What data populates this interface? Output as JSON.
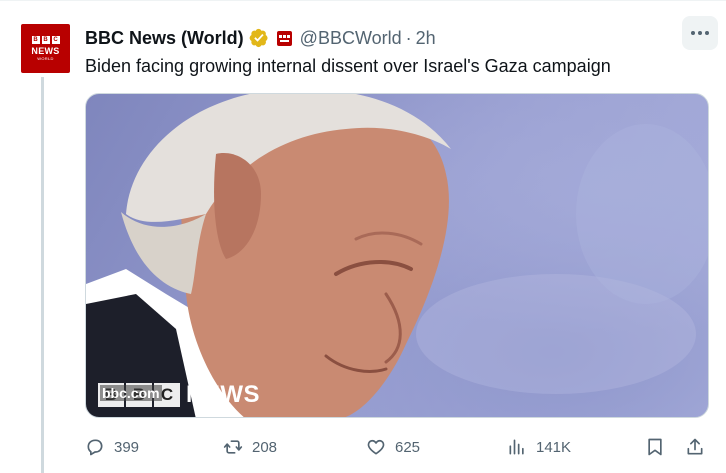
{
  "tweet": {
    "account": {
      "display_name": "BBC News (World)",
      "handle": "@BBCWorld",
      "separator": "·",
      "time": "2h",
      "avatar_text": {
        "blocks": [
          "B",
          "B",
          "C"
        ],
        "news": "NEWS",
        "world": "WORLD"
      },
      "verified": true,
      "verified_color": "#e2b719"
    },
    "text": "Biden facing growing internal dissent over Israel's Gaza campaign",
    "media": {
      "watermark": {
        "url": "bbc.com",
        "blocks": [
          "B",
          "B",
          "C"
        ],
        "label": "NEWS"
      }
    },
    "actions": {
      "reply_count": "399",
      "retweet_count": "208",
      "like_count": "625",
      "views_count": "141K"
    }
  },
  "icons": [
    "more-icon",
    "verified-icon",
    "affiliate-badge-icon",
    "reply-icon",
    "retweet-icon",
    "like-icon",
    "views-icon",
    "bookmark-icon",
    "share-icon"
  ],
  "colors": {
    "brand_red": "#b80000",
    "muted_text": "#536471",
    "text": "#0f1419"
  }
}
